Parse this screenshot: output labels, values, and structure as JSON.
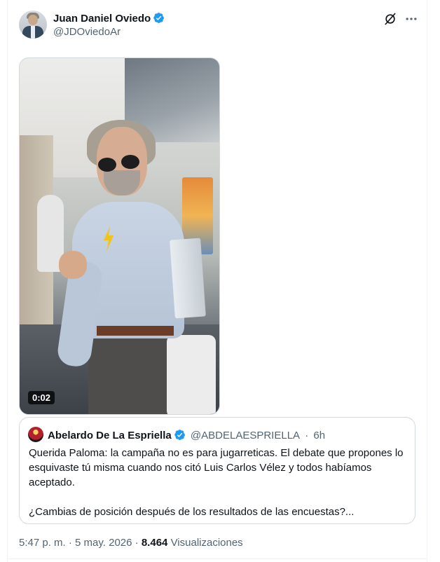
{
  "post": {
    "author": {
      "name": "Juan Daniel Oviedo",
      "handle": "@JDOviedoAr",
      "verified": true
    },
    "video": {
      "duration": "0:02"
    },
    "quoted": {
      "author_name": "Abelardo De La Espriella",
      "author_handle": "@ABDELAESPRIELLA",
      "age": "6h",
      "text_line1": "Querida Paloma: la campaña no es para jugarreticas. El debate que propones lo esquivaste tú misma cuando nos citó Luis Carlos Vélez y todos habíamos aceptado.",
      "text_line2": "¿Cambias de posición después de los resultados de las encuestas?..."
    },
    "meta": {
      "time": "5:47 p. m.",
      "date": "5 may. 2026",
      "separator": "·",
      "views_count": "8.464",
      "views_label": "Visualizaciones"
    }
  },
  "icons": {
    "verified": "verified-badge-icon",
    "grok": "grok-icon",
    "more": "more-options-icon"
  },
  "colors": {
    "verified_blue": "#1d9bf0",
    "secondary_text": "#536471",
    "primary_text": "#0f1419",
    "border": "#cfd9de"
  }
}
